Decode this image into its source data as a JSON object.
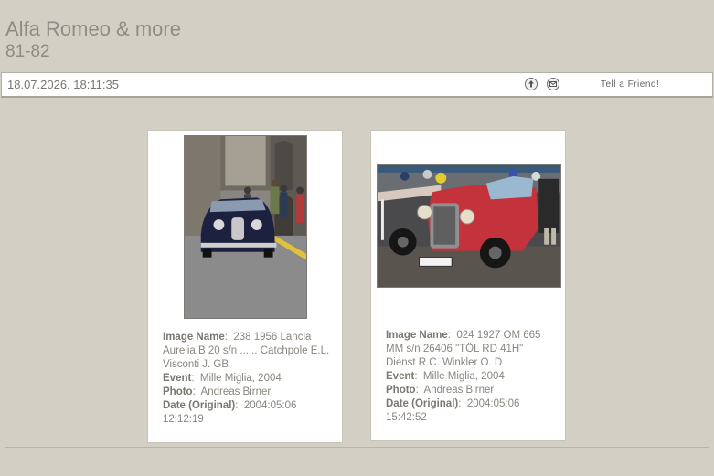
{
  "header": {
    "title": "Alfa Romeo & more",
    "subtitle": "81-82"
  },
  "toolbar": {
    "datetime": "18.07.2026, 18:11:35",
    "icons": [
      "back-icon",
      "mail-icon"
    ],
    "tell_friend": "Tell a Friend!"
  },
  "cards": [
    {
      "photo_desc": "dark-blue-lancia-aurelia-street",
      "fields": [
        {
          "label": "Image Name",
          "value": "238 1956 Lancia Aurelia B 20 s/n ...... Catchpole E.L. Visconti J. GB"
        },
        {
          "label": "Event",
          "value": "Mille Miglia, 2004"
        },
        {
          "label": "Photo",
          "value": "Andreas Birner"
        },
        {
          "label": "Date (Original)",
          "value": "2004:05:06 12:12:19"
        }
      ]
    },
    {
      "photo_desc": "red-om-665-roadster",
      "plate": "TÖL RD41H",
      "fields": [
        {
          "label": "Image Name",
          "value": "024 1927 OM 665 MM s/n 26406 \"TÖL RD 41H\" Dienst R.C. Winkler O. D"
        },
        {
          "label": "Event",
          "value": "Mille Miglia, 2004"
        },
        {
          "label": "Photo",
          "value": "Andreas Birner"
        },
        {
          "label": "Date (Original)",
          "value": "2004:05:06 15:42:52"
        }
      ]
    }
  ],
  "colors": {
    "background": "#d4cfc4",
    "title": "#8f8b85",
    "card": "#ffffff"
  }
}
